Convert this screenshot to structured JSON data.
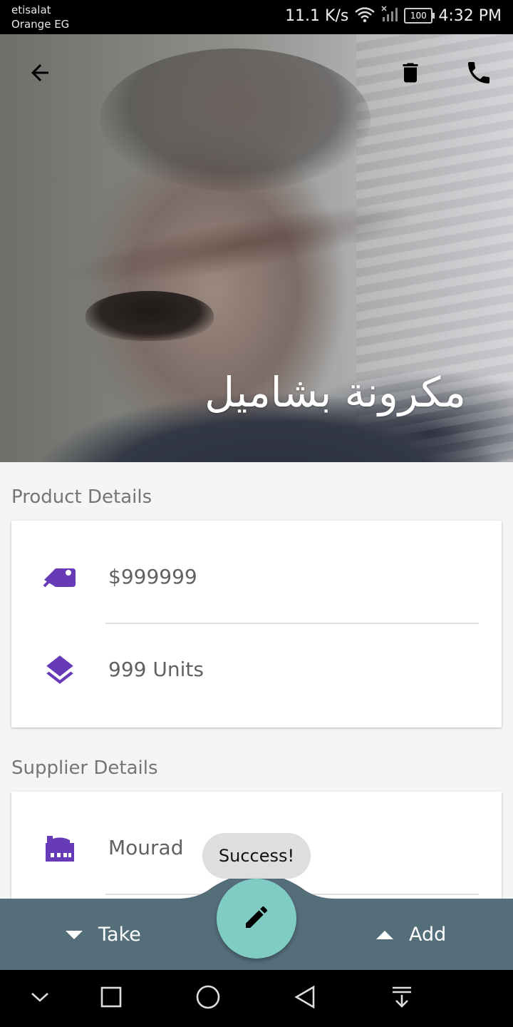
{
  "status_bar": {
    "carrier_line1": "etisalat",
    "carrier_line2": "Orange EG",
    "network_speed": "11.1 K/s",
    "battery": "100",
    "time": "4:32 PM"
  },
  "header": {
    "title": "مكرونة بشاميل",
    "icons": [
      "arrow-back-icon",
      "delete-icon",
      "phone-icon"
    ]
  },
  "product_section": {
    "title": "Product Details",
    "price": "$999999",
    "quantity": "999 Units"
  },
  "supplier_section": {
    "title": "Supplier Details",
    "name": "Mourad"
  },
  "toast": {
    "text": "Success!"
  },
  "bottom_bar": {
    "take_label": "Take",
    "add_label": "Add"
  },
  "colors": {
    "accent_purple": "#673ab7",
    "bottom_bar": "#546e7a",
    "fab": "#80cbc4"
  }
}
